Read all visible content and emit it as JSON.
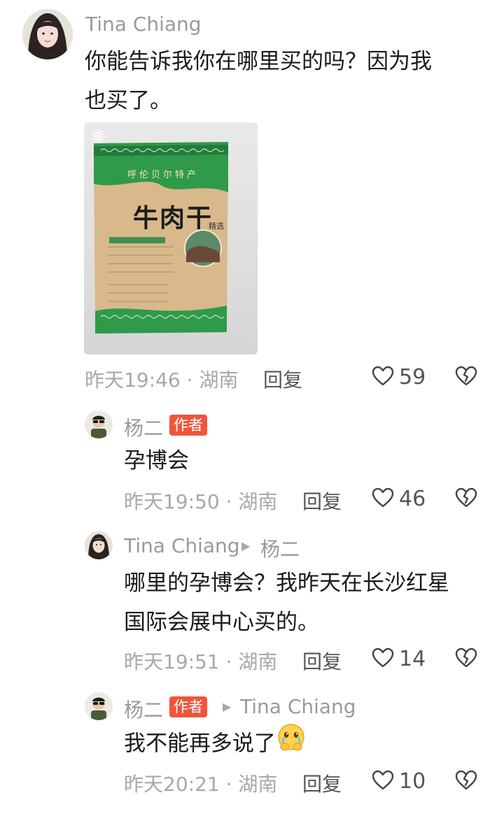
{
  "comments": [
    {
      "name": "Tina Chiang",
      "text_line1": "你能告诉我你在哪里买的吗？因为我",
      "text_line2": "也买了。",
      "time": "昨天19:46",
      "region": "湖南",
      "reply_label": "回复",
      "likes": "59"
    }
  ],
  "replies": [
    {
      "name": "杨二",
      "badge": "作者",
      "text": "孕博会",
      "time": "昨天19:50",
      "region": "湖南",
      "reply_label": "回复",
      "likes": "46"
    },
    {
      "name": "Tina Chiang",
      "reply_to": "杨二",
      "text_line1": "哪里的孕博会？我昨天在长沙红星",
      "text_line2": "国际会展中心买的。",
      "time": "昨天19:51",
      "region": "湖南",
      "reply_label": "回复",
      "likes": "14"
    },
    {
      "name": "杨二",
      "badge": "作者",
      "reply_to": "Tina Chiang",
      "text": "我不能再多说了",
      "time": "昨天20:21",
      "region": "湖南",
      "reply_label": "回复",
      "likes": "10"
    }
  ],
  "product": {
    "top_label": "呼伦贝尔特产",
    "title": "牛肉干",
    "sub": "精选"
  },
  "separator": "·",
  "colors": {
    "badge": "#f0553b",
    "pack_green": "#2f9a4a",
    "pack_tan": "#d9b88c"
  }
}
